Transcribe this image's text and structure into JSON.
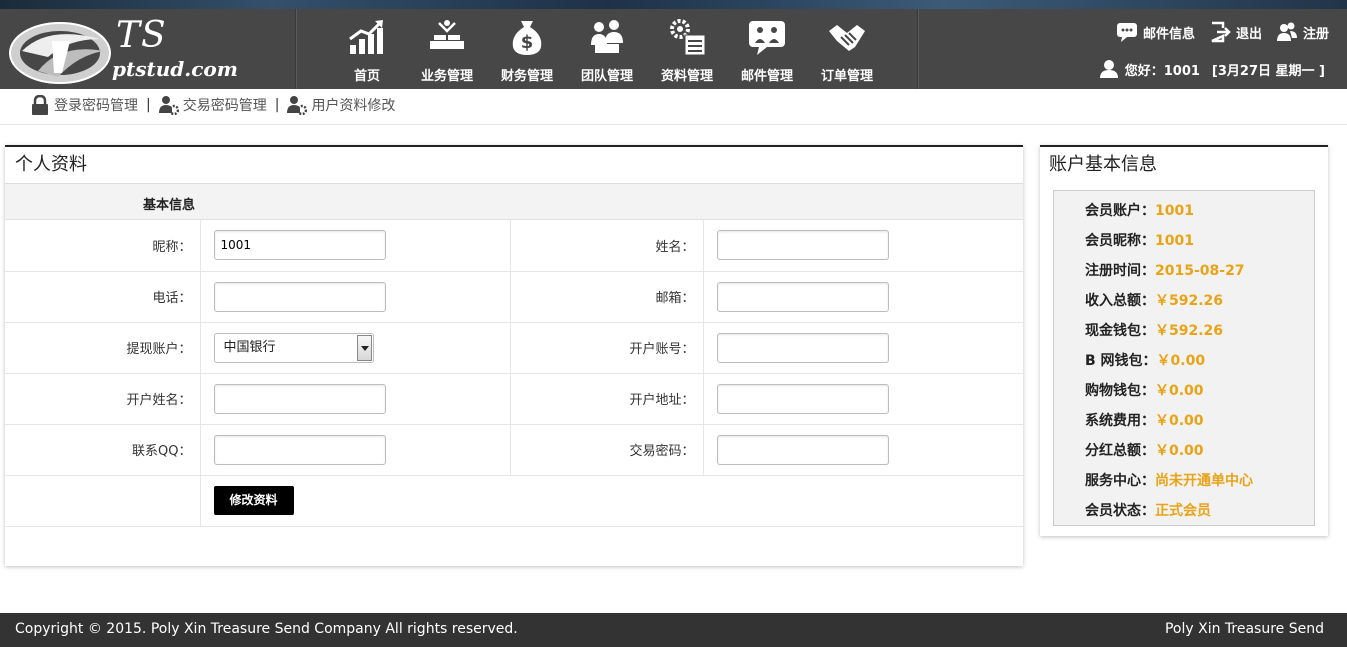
{
  "brand": {
    "logo_ts": "TS",
    "logo_url": "ptstud.com"
  },
  "nav": [
    {
      "label": "首页",
      "icon": "chart-icon"
    },
    {
      "label": "业务管理",
      "icon": "business-icon"
    },
    {
      "label": "财务管理",
      "icon": "money-bag-icon"
    },
    {
      "label": "团队管理",
      "icon": "team-icon"
    },
    {
      "label": "资料管理",
      "icon": "gear-list-icon"
    },
    {
      "label": "邮件管理",
      "icon": "chat-icon"
    },
    {
      "label": "订单管理",
      "icon": "handshake-icon"
    }
  ],
  "header_right": {
    "mail": "邮件信息",
    "logout": "退出",
    "register": "注册",
    "greeting": "您好：1001",
    "date": "[3月27日 星期一 ]"
  },
  "subnav": {
    "login_pwd": "登录密码管理",
    "trade_pwd": "交易密码管理",
    "profile": "用户资料修改",
    "sep": "|"
  },
  "profile": {
    "title": "个人资料",
    "section": "基本信息",
    "rows": [
      {
        "left_label": "昵称：",
        "left_value": "1001",
        "right_label": "姓名：",
        "right_value": ""
      },
      {
        "left_label": "电话：",
        "left_value": "",
        "right_label": "邮箱：",
        "right_value": ""
      },
      {
        "left_label": "提现账户：",
        "left_value": "中国银行",
        "right_label": "开户账号：",
        "right_value": ""
      },
      {
        "left_label": "开户姓名：",
        "left_value": "",
        "right_label": "开户地址：",
        "right_value": ""
      },
      {
        "left_label": "联系QQ：",
        "left_value": "",
        "right_label": "交易密码：",
        "right_value": ""
      }
    ],
    "submit": "修改资料"
  },
  "account": {
    "title": "账户基本信息",
    "items": [
      {
        "label": "会员账户：",
        "value": "1001"
      },
      {
        "label": "会员昵称：",
        "value": "1001"
      },
      {
        "label": "注册时间：",
        "value": "2015-08-27"
      },
      {
        "label": "收入总额：",
        "value": "￥592.26"
      },
      {
        "label": "现金钱包：",
        "value": "￥592.26"
      },
      {
        "label": "B 网钱包：",
        "value": "￥0.00"
      },
      {
        "label": "购物钱包：",
        "value": "￥0.00"
      },
      {
        "label": "系统费用：",
        "value": "￥0.00"
      },
      {
        "label": "分红总额：",
        "value": "￥0.00"
      },
      {
        "label": "服务中心：",
        "value": "尚未开通单中心"
      },
      {
        "label": "会员状态：",
        "value": "正式会员"
      }
    ]
  },
  "footer": {
    "copyright": "Copyright © 2015. Poly Xin Treasure Send Company All rights reserved.",
    "company": "Poly Xin Treasure Send"
  },
  "colors": {
    "header_bg": "#474747",
    "accent_value": "#e8a317",
    "footer_bg": "#333333"
  }
}
